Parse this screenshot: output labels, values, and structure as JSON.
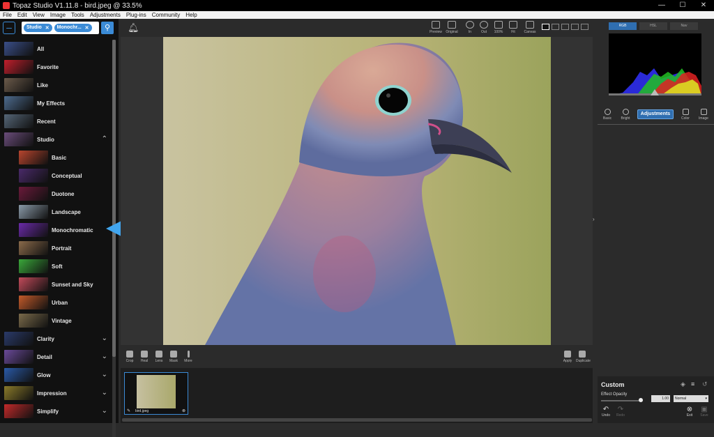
{
  "window": {
    "title": "Topaz Studio V1.11.8 - bird.jpeg @ 33.5%",
    "controls": [
      "—",
      "☐",
      "✕"
    ]
  },
  "menu": [
    "File",
    "Edit",
    "View",
    "Image",
    "Tools",
    "Adjustments",
    "Plug-ins",
    "Community",
    "Help"
  ],
  "search": {
    "chips": [
      "Studio",
      "Monochr..."
    ]
  },
  "categories": [
    {
      "label": "All",
      "color": "#3a4f8a",
      "sub": false,
      "chev": ""
    },
    {
      "label": "Favorite",
      "color": "#c21f2c",
      "sub": false,
      "chev": ""
    },
    {
      "label": "Like",
      "color": "#6b5a4a",
      "sub": false,
      "chev": ""
    },
    {
      "label": "My Effects",
      "color": "#4d6b8e",
      "sub": false,
      "chev": ""
    },
    {
      "label": "Recent",
      "color": "#556677",
      "sub": false,
      "chev": ""
    },
    {
      "label": "Studio",
      "color": "#6a4c7a",
      "sub": false,
      "chev": "⌃"
    },
    {
      "label": "Basic",
      "color": "#b8452e",
      "sub": true,
      "chev": ""
    },
    {
      "label": "Conceptual",
      "color": "#4a2a6a",
      "sub": true,
      "chev": ""
    },
    {
      "label": "Duotone",
      "color": "#6a1a3a",
      "sub": true,
      "chev": ""
    },
    {
      "label": "Landscape",
      "color": "#8a9aa8",
      "sub": true,
      "chev": ""
    },
    {
      "label": "Monochromatic",
      "color": "#6a2aa8",
      "sub": true,
      "chev": ""
    },
    {
      "label": "Portrait",
      "color": "#8a6a4a",
      "sub": true,
      "chev": ""
    },
    {
      "label": "Soft",
      "color": "#3aa83a",
      "sub": true,
      "chev": ""
    },
    {
      "label": "Sunset and Sky",
      "color": "#c24a5a",
      "sub": true,
      "chev": ""
    },
    {
      "label": "Urban",
      "color": "#c25a2a",
      "sub": true,
      "chev": ""
    },
    {
      "label": "Vintage",
      "color": "#7a6a4a",
      "sub": true,
      "chev": ""
    },
    {
      "label": "Clarity",
      "color": "#2a3a6a",
      "sub": false,
      "chev": "⌄"
    },
    {
      "label": "Detail",
      "color": "#6a4a9a",
      "sub": false,
      "chev": "⌄"
    },
    {
      "label": "Glow",
      "color": "#2a5aa8",
      "sub": false,
      "chev": "⌄"
    },
    {
      "label": "Impression",
      "color": "#8a7a2a",
      "sub": false,
      "chev": "⌄"
    },
    {
      "label": "Simplify",
      "color": "#c22a2a",
      "sub": false,
      "chev": "⌄"
    }
  ],
  "top_tools": [
    "Preview",
    "Original",
    "In",
    "Out",
    "100%",
    "Fit",
    "Canvas"
  ],
  "film_tools": [
    "Crop",
    "Heal",
    "Lens",
    "Mask",
    "More"
  ],
  "film_right": [
    "Apply",
    "Duplicate"
  ],
  "thumbnail": {
    "name": "bird.jpeg"
  },
  "histogram_tabs": [
    "RGB",
    "HSL",
    "Nav"
  ],
  "panel_tabs": [
    "Basic",
    "Bright",
    "Color",
    "Image"
  ],
  "adjustments_label": "Adjustments",
  "bottom": {
    "custom": "Custom",
    "opacity_label": "Effect Opacity",
    "opacity_value": "1.00",
    "opacity_fraction": 0.95,
    "mode": "Normal",
    "undo": "Undo",
    "redo": "Redo",
    "exit": "Exit",
    "save": "Save"
  },
  "accent": "#3b8bd6"
}
